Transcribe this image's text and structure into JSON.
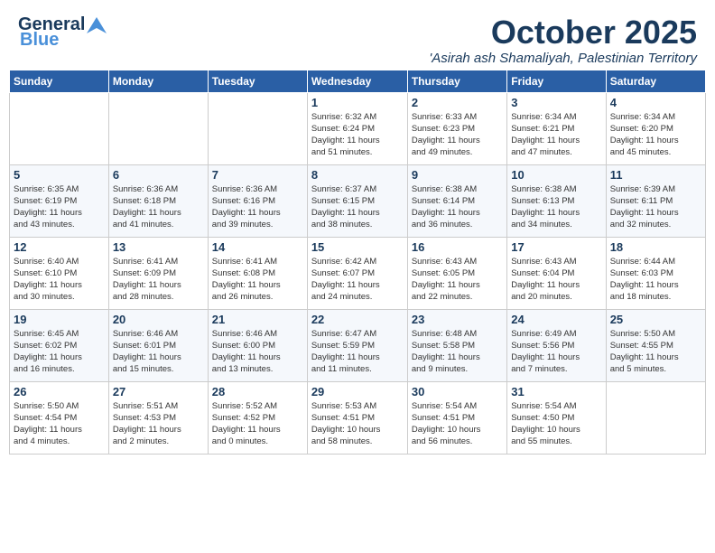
{
  "header": {
    "logo_line1": "General",
    "logo_line2": "Blue",
    "month": "October 2025",
    "location": "'Asirah ash Shamaliyah, Palestinian Territory"
  },
  "weekdays": [
    "Sunday",
    "Monday",
    "Tuesday",
    "Wednesday",
    "Thursday",
    "Friday",
    "Saturday"
  ],
  "weeks": [
    [
      {
        "day": "",
        "info": ""
      },
      {
        "day": "",
        "info": ""
      },
      {
        "day": "",
        "info": ""
      },
      {
        "day": "1",
        "info": "Sunrise: 6:32 AM\nSunset: 6:24 PM\nDaylight: 11 hours\nand 51 minutes."
      },
      {
        "day": "2",
        "info": "Sunrise: 6:33 AM\nSunset: 6:23 PM\nDaylight: 11 hours\nand 49 minutes."
      },
      {
        "day": "3",
        "info": "Sunrise: 6:34 AM\nSunset: 6:21 PM\nDaylight: 11 hours\nand 47 minutes."
      },
      {
        "day": "4",
        "info": "Sunrise: 6:34 AM\nSunset: 6:20 PM\nDaylight: 11 hours\nand 45 minutes."
      }
    ],
    [
      {
        "day": "5",
        "info": "Sunrise: 6:35 AM\nSunset: 6:19 PM\nDaylight: 11 hours\nand 43 minutes."
      },
      {
        "day": "6",
        "info": "Sunrise: 6:36 AM\nSunset: 6:18 PM\nDaylight: 11 hours\nand 41 minutes."
      },
      {
        "day": "7",
        "info": "Sunrise: 6:36 AM\nSunset: 6:16 PM\nDaylight: 11 hours\nand 39 minutes."
      },
      {
        "day": "8",
        "info": "Sunrise: 6:37 AM\nSunset: 6:15 PM\nDaylight: 11 hours\nand 38 minutes."
      },
      {
        "day": "9",
        "info": "Sunrise: 6:38 AM\nSunset: 6:14 PM\nDaylight: 11 hours\nand 36 minutes."
      },
      {
        "day": "10",
        "info": "Sunrise: 6:38 AM\nSunset: 6:13 PM\nDaylight: 11 hours\nand 34 minutes."
      },
      {
        "day": "11",
        "info": "Sunrise: 6:39 AM\nSunset: 6:11 PM\nDaylight: 11 hours\nand 32 minutes."
      }
    ],
    [
      {
        "day": "12",
        "info": "Sunrise: 6:40 AM\nSunset: 6:10 PM\nDaylight: 11 hours\nand 30 minutes."
      },
      {
        "day": "13",
        "info": "Sunrise: 6:41 AM\nSunset: 6:09 PM\nDaylight: 11 hours\nand 28 minutes."
      },
      {
        "day": "14",
        "info": "Sunrise: 6:41 AM\nSunset: 6:08 PM\nDaylight: 11 hours\nand 26 minutes."
      },
      {
        "day": "15",
        "info": "Sunrise: 6:42 AM\nSunset: 6:07 PM\nDaylight: 11 hours\nand 24 minutes."
      },
      {
        "day": "16",
        "info": "Sunrise: 6:43 AM\nSunset: 6:05 PM\nDaylight: 11 hours\nand 22 minutes."
      },
      {
        "day": "17",
        "info": "Sunrise: 6:43 AM\nSunset: 6:04 PM\nDaylight: 11 hours\nand 20 minutes."
      },
      {
        "day": "18",
        "info": "Sunrise: 6:44 AM\nSunset: 6:03 PM\nDaylight: 11 hours\nand 18 minutes."
      }
    ],
    [
      {
        "day": "19",
        "info": "Sunrise: 6:45 AM\nSunset: 6:02 PM\nDaylight: 11 hours\nand 16 minutes."
      },
      {
        "day": "20",
        "info": "Sunrise: 6:46 AM\nSunset: 6:01 PM\nDaylight: 11 hours\nand 15 minutes."
      },
      {
        "day": "21",
        "info": "Sunrise: 6:46 AM\nSunset: 6:00 PM\nDaylight: 11 hours\nand 13 minutes."
      },
      {
        "day": "22",
        "info": "Sunrise: 6:47 AM\nSunset: 5:59 PM\nDaylight: 11 hours\nand 11 minutes."
      },
      {
        "day": "23",
        "info": "Sunrise: 6:48 AM\nSunset: 5:58 PM\nDaylight: 11 hours\nand 9 minutes."
      },
      {
        "day": "24",
        "info": "Sunrise: 6:49 AM\nSunset: 5:56 PM\nDaylight: 11 hours\nand 7 minutes."
      },
      {
        "day": "25",
        "info": "Sunrise: 5:50 AM\nSunset: 4:55 PM\nDaylight: 11 hours\nand 5 minutes."
      }
    ],
    [
      {
        "day": "26",
        "info": "Sunrise: 5:50 AM\nSunset: 4:54 PM\nDaylight: 11 hours\nand 4 minutes."
      },
      {
        "day": "27",
        "info": "Sunrise: 5:51 AM\nSunset: 4:53 PM\nDaylight: 11 hours\nand 2 minutes."
      },
      {
        "day": "28",
        "info": "Sunrise: 5:52 AM\nSunset: 4:52 PM\nDaylight: 11 hours\nand 0 minutes."
      },
      {
        "day": "29",
        "info": "Sunrise: 5:53 AM\nSunset: 4:51 PM\nDaylight: 10 hours\nand 58 minutes."
      },
      {
        "day": "30",
        "info": "Sunrise: 5:54 AM\nSunset: 4:51 PM\nDaylight: 10 hours\nand 56 minutes."
      },
      {
        "day": "31",
        "info": "Sunrise: 5:54 AM\nSunset: 4:50 PM\nDaylight: 10 hours\nand 55 minutes."
      },
      {
        "day": "",
        "info": ""
      }
    ]
  ]
}
